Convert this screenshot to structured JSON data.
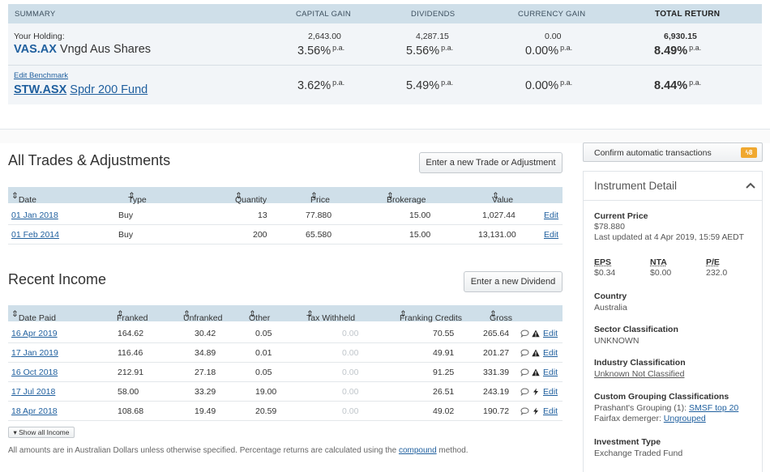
{
  "summary": {
    "headers": {
      "summary": "SUMMARY",
      "capital_gain": "CAPITAL GAIN",
      "dividends": "DIVIDENDS",
      "currency_gain": "CURRENCY GAIN",
      "total_return": "TOTAL RETURN"
    },
    "holding": {
      "label": "Your Holding:",
      "ticker": "VAS.AX",
      "name": "Vngd Aus Shares",
      "capital_gain_amt": "2,643.00",
      "capital_gain_pct": "3.56%",
      "dividends_amt": "4,287.15",
      "dividends_pct": "5.56%",
      "currency_amt": "0.00",
      "currency_pct": "0.00%",
      "total_amt": "6,930.15",
      "total_pct": "8.49%"
    },
    "benchmark": {
      "edit_label": "Edit Benchmark",
      "ticker": "STW.ASX",
      "name": "Spdr 200 Fund",
      "capital_gain_pct": "3.62%",
      "dividends_pct": "5.49%",
      "currency_pct": "0.00%",
      "total_pct": "8.44%"
    },
    "pa": "p.a."
  },
  "trades": {
    "title": "All Trades & Adjustments",
    "button": "Enter a new Trade or Adjustment",
    "columns": [
      "Date",
      "Type",
      "Quantity",
      "Price",
      "Brokerage",
      "Value"
    ],
    "rows": [
      {
        "date": "01 Jan 2018",
        "type": "Buy",
        "quantity": "13",
        "price": "77.880",
        "brokerage": "15.00",
        "value": "1,027.44",
        "edit": "Edit"
      },
      {
        "date": "01 Feb 2014",
        "type": "Buy",
        "quantity": "200",
        "price": "65.580",
        "brokerage": "15.00",
        "value": "13,131.00",
        "edit": "Edit"
      }
    ]
  },
  "income": {
    "title": "Recent Income",
    "button": "Enter a new Dividend",
    "columns": [
      "Date Paid",
      "Franked",
      "Unfranked",
      "Other",
      "Tax Withheld",
      "Franking Credits",
      "Gross"
    ],
    "rows": [
      {
        "date": "16 Apr 2019",
        "franked": "164.62",
        "unfranked": "30.42",
        "other": "0.05",
        "tax": "0.00",
        "credits": "70.55",
        "gross": "265.64",
        "icon": "warning-icon",
        "edit": "Edit"
      },
      {
        "date": "17 Jan 2019",
        "franked": "116.46",
        "unfranked": "34.89",
        "other": "0.01",
        "tax": "0.00",
        "credits": "49.91",
        "gross": "201.27",
        "icon": "warning-icon",
        "edit": "Edit"
      },
      {
        "date": "16 Oct 2018",
        "franked": "212.91",
        "unfranked": "27.18",
        "other": "0.05",
        "tax": "0.00",
        "credits": "91.25",
        "gross": "331.39",
        "icon": "warning-icon",
        "edit": "Edit"
      },
      {
        "date": "17 Jul 2018",
        "franked": "58.00",
        "unfranked": "33.29",
        "other": "19.00",
        "tax": "0.00",
        "credits": "26.51",
        "gross": "243.19",
        "icon": "lightning-icon",
        "edit": "Edit"
      },
      {
        "date": "18 Apr 2018",
        "franked": "108.68",
        "unfranked": "19.49",
        "other": "20.59",
        "tax": "0.00",
        "credits": "49.02",
        "gross": "190.72",
        "icon": "lightning-icon",
        "edit": "Edit"
      }
    ],
    "show_all": "Show all Income"
  },
  "footnote": {
    "before": "All amounts are in Australian Dollars unless otherwise specified. Percentage returns are calculated using the ",
    "link": "compound",
    "after": " method."
  },
  "confirm": {
    "label": "Confirm automatic transactions",
    "badge": "8"
  },
  "instrument": {
    "title": "Instrument Detail",
    "current_price_label": "Current Price",
    "current_price": "$78.880",
    "last_updated": "Last updated at 4 Apr 2019, 15:59 AEDT",
    "eps_label": "EPS",
    "eps": "$0.34",
    "nta_label": "NTA",
    "nta": "$0.00",
    "pe_label": "P/E",
    "pe": "232.0",
    "country_label": "Country",
    "country": "Australia",
    "sector_label": "Sector Classification",
    "sector": "UNKNOWN",
    "industry_label": "Industry Classification",
    "industry": "Unknown Not Classified",
    "custom_label": "Custom Grouping Classifications",
    "custom_1_prefix": "Prashant's Grouping (1):",
    "custom_1_link": "SMSF top 20",
    "custom_2_prefix": "Fairfax demerger:",
    "custom_2_link": "Ungrouped",
    "investment_type_label": "Investment Type",
    "investment_type": "Exchange Traded Fund"
  },
  "colors": {
    "header_bg": "#cfdfe9",
    "summary_bg": "#f2f5f8",
    "link": "#1f5f9e",
    "badge": "#f0a830"
  }
}
